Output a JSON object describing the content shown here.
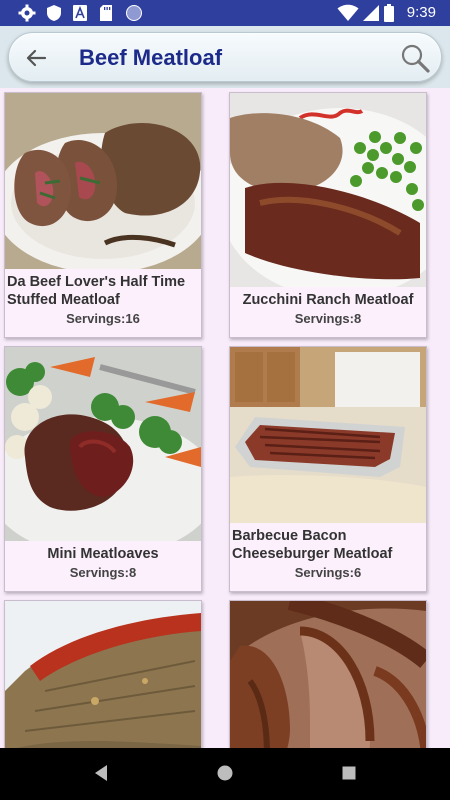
{
  "status_bar": {
    "time": "9:39",
    "icons": [
      "settings-icon",
      "shield-icon",
      "font-icon",
      "sd-card-icon",
      "circle-icon",
      "wifi-icon",
      "battery-icon"
    ]
  },
  "search": {
    "query": "Beef Meatloaf",
    "back_icon": "back-arrow-icon",
    "search_icon": "search-icon"
  },
  "recipes": [
    {
      "title": "Da Beef Lover's Half Time Stuffed Meatloaf",
      "servings": "Servings:16"
    },
    {
      "title": "Zucchini Ranch Meatloaf",
      "servings": "Servings:8"
    },
    {
      "title": "Mini Meatloaves",
      "servings": "Servings:8"
    },
    {
      "title": "Barbecue Bacon Cheeseburger Meatloaf",
      "servings": "Servings:6"
    },
    {
      "title": "",
      "servings": ""
    },
    {
      "title": "",
      "servings": ""
    }
  ],
  "nav": {
    "back": "nav-back-icon",
    "home": "nav-home-icon",
    "recents": "nav-recents-icon"
  },
  "colors": {
    "status_bar": "#2f3f9e",
    "app_bar": "#dbe7ec",
    "title": "#1c2a8a",
    "card_bg": "#fbf0fc"
  }
}
